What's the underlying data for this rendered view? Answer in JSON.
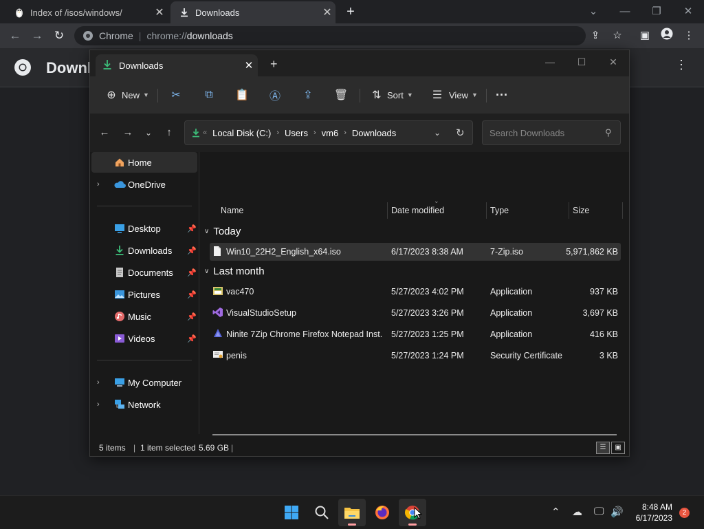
{
  "chrome": {
    "tabs": [
      {
        "title": "Index of /isos/windows/"
      },
      {
        "title": "Downloads"
      }
    ],
    "omnibox_chip": "Chrome",
    "url_scheme": "chrome://",
    "url_host": "downloads",
    "page_title": "Downloads"
  },
  "explorer": {
    "tab_title": "Downloads",
    "commands": {
      "new_label": "New",
      "sort_label": "Sort",
      "view_label": "View"
    },
    "breadcrumb": [
      "Local Disk (C:)",
      "Users",
      "vm6",
      "Downloads"
    ],
    "search_placeholder": "Search Downloads",
    "sidebar": {
      "home": "Home",
      "onedrive": "OneDrive",
      "quick": [
        {
          "label": "Desktop",
          "icon": "desktop-icon"
        },
        {
          "label": "Downloads",
          "icon": "downloads-icon"
        },
        {
          "label": "Documents",
          "icon": "documents-icon"
        },
        {
          "label": "Pictures",
          "icon": "pictures-icon"
        },
        {
          "label": "Music",
          "icon": "music-icon"
        },
        {
          "label": "Videos",
          "icon": "videos-icon"
        }
      ],
      "my_computer": "My Computer",
      "network": "Network"
    },
    "columns": {
      "name": "Name",
      "date": "Date modified",
      "type": "Type",
      "size": "Size"
    },
    "groups": {
      "today": "Today",
      "last_month": "Last month"
    },
    "files": [
      {
        "name": "Win10_22H2_English_x64.iso",
        "date": "6/17/2023 8:38 AM",
        "type": "7-Zip.iso",
        "size": "5,971,862 KB",
        "selected": true
      },
      {
        "name": "vac470",
        "date": "5/27/2023 4:02 PM",
        "type": "Application",
        "size": "937 KB"
      },
      {
        "name": "VisualStudioSetup",
        "date": "5/27/2023 3:26 PM",
        "type": "Application",
        "size": "3,697 KB"
      },
      {
        "name": "Ninite 7Zip Chrome Firefox Notepad Inst...",
        "date": "5/27/2023 1:25 PM",
        "type": "Application",
        "size": "416 KB"
      },
      {
        "name": "penis",
        "date": "5/27/2023 1:24 PM",
        "type": "Security Certificate",
        "size": "3 KB"
      }
    ],
    "status": {
      "count": "5 items",
      "selection": "1 item selected",
      "selection_size": "5.69 GB"
    }
  },
  "taskbar": {
    "time": "8:48 AM",
    "date": "6/17/2023",
    "badge": "2"
  },
  "colors": {
    "accent": "#3dbf7a",
    "explorer_bg": "#191919",
    "chrome_toolbar": "#35363a"
  }
}
